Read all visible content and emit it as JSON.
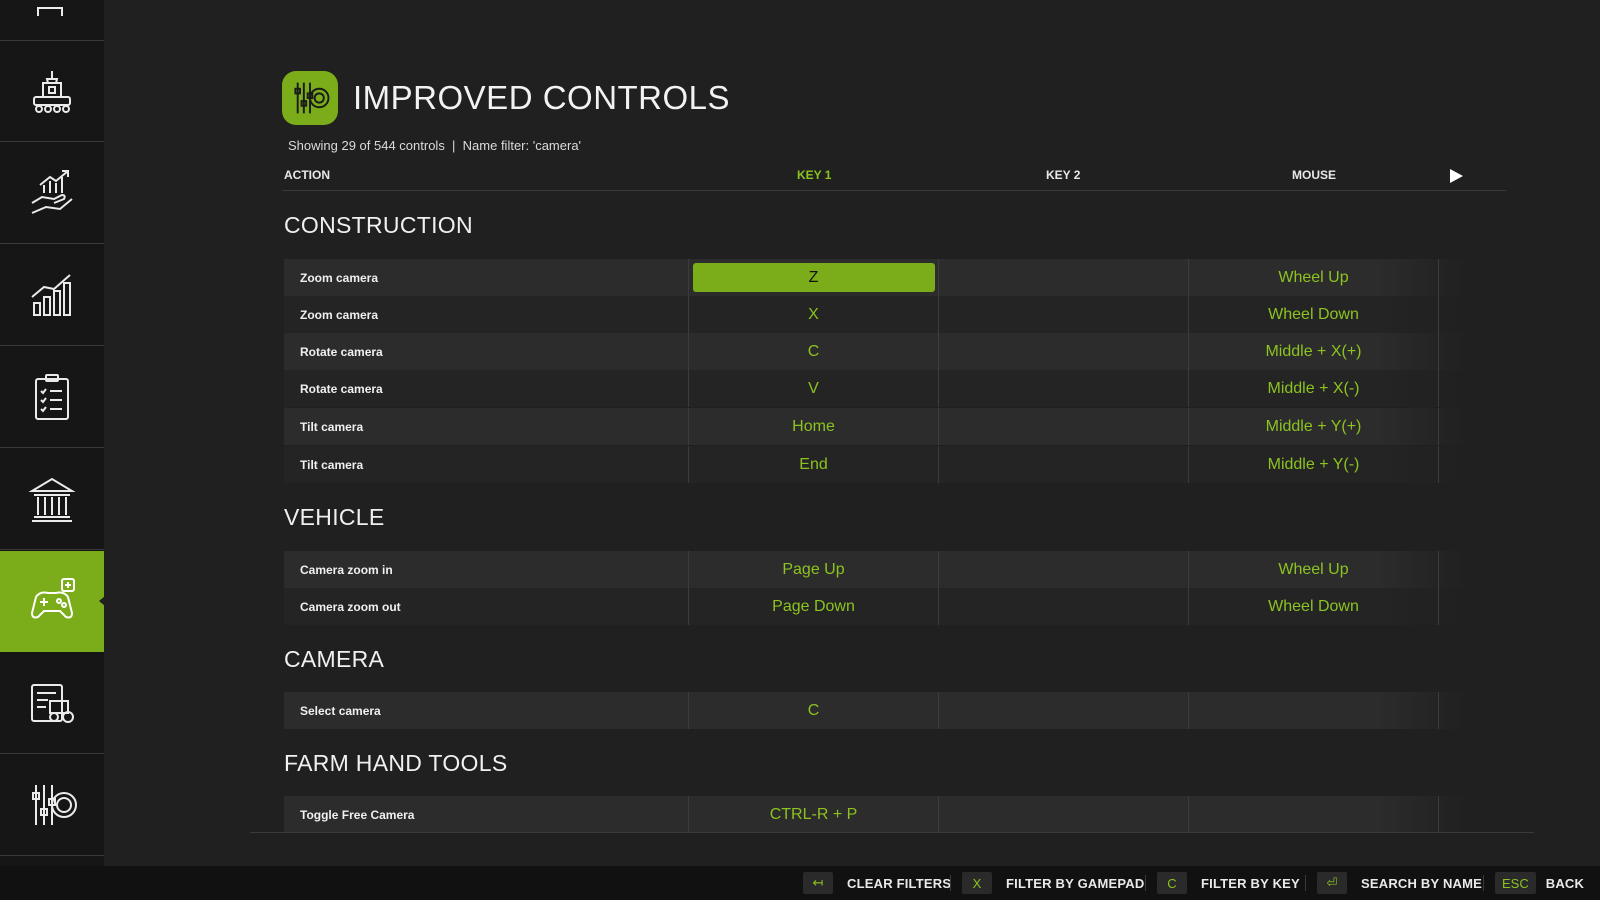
{
  "header": {
    "title": "IMPROVED CONTROLS",
    "subtitle": "Showing 29 of 544 controls  |  Name filter: 'camera'"
  },
  "columns": {
    "action": "ACTION",
    "key1": "KEY 1",
    "key2": "KEY 2",
    "mouse": "MOUSE"
  },
  "sidebar": {
    "items": [
      {
        "icon": "map-icon"
      },
      {
        "icon": "production-icon"
      },
      {
        "icon": "finance-icon"
      },
      {
        "icon": "statistics-icon"
      },
      {
        "icon": "contracts-icon"
      },
      {
        "icon": "bank-icon"
      },
      {
        "icon": "gamepad-icon",
        "active": true
      },
      {
        "icon": "vehicle-list-icon"
      },
      {
        "icon": "settings-icon"
      }
    ]
  },
  "sections": [
    {
      "title": "CONSTRUCTION",
      "rows": [
        {
          "action": "Zoom camera",
          "key1": "Z",
          "key2": "",
          "mouse": "Wheel Up"
        },
        {
          "action": "Zoom camera",
          "key1": "X",
          "key2": "",
          "mouse": "Wheel Down"
        },
        {
          "action": "Rotate camera",
          "key1": "C",
          "key2": "",
          "mouse": "Middle + X(+)"
        },
        {
          "action": "Rotate camera",
          "key1": "V",
          "key2": "",
          "mouse": "Middle + X(-)"
        },
        {
          "action": "Tilt camera",
          "key1": "Home",
          "key2": "",
          "mouse": "Middle + Y(+)"
        },
        {
          "action": "Tilt camera",
          "key1": "End",
          "key2": "",
          "mouse": "Middle + Y(-)"
        }
      ]
    },
    {
      "title": "VEHICLE",
      "rows": [
        {
          "action": "Camera zoom in",
          "key1": "Page Up",
          "key2": "",
          "mouse": "Wheel Up"
        },
        {
          "action": "Camera zoom out",
          "key1": "Page Down",
          "key2": "",
          "mouse": "Wheel Down"
        }
      ]
    },
    {
      "title": "CAMERA",
      "rows": [
        {
          "action": "Select camera",
          "key1": "C",
          "key2": "",
          "mouse": ""
        }
      ]
    },
    {
      "title": "FARM HAND TOOLS",
      "rows": [
        {
          "action": "Toggle Free Camera",
          "key1": "CTRL-R + P",
          "key2": "",
          "mouse": ""
        }
      ]
    }
  ],
  "footer": {
    "clear": {
      "key": "↤",
      "label": "CLEAR FILTERS"
    },
    "gamepad": {
      "key": "X",
      "label": "FILTER BY GAMEPAD"
    },
    "bykey": {
      "key": "C",
      "label": "FILTER BY KEY"
    },
    "search": {
      "key": "⏎",
      "label": "SEARCH BY NAME"
    },
    "back": {
      "key": "ESC",
      "label": "BACK"
    }
  },
  "colors": {
    "accent": "#7bad1a",
    "accent_text": "#8cc320",
    "background": "#202020",
    "sidebar": "#161616"
  }
}
